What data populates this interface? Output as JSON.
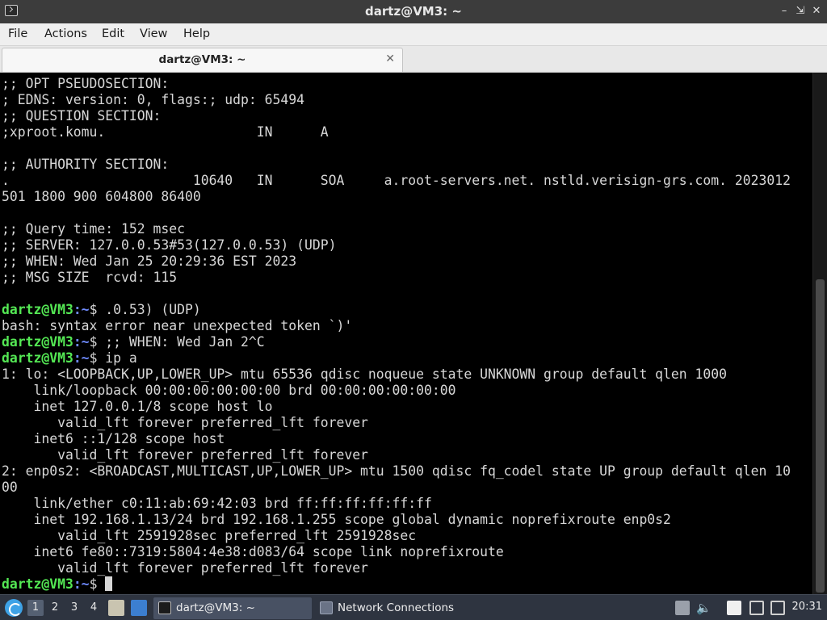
{
  "window": {
    "title": "dartz@VM3: ~",
    "controls": [
      "minimize",
      "maximize",
      "close"
    ]
  },
  "menubar": {
    "items": [
      "File",
      "Actions",
      "Edit",
      "View",
      "Help"
    ]
  },
  "tab": {
    "label": "dartz@VM3: ~"
  },
  "terminal": {
    "lines": [
      {
        "text": ";; OPT PSEUDOSECTION:"
      },
      {
        "text": "; EDNS: version: 0, flags:; udp: 65494"
      },
      {
        "text": ";; QUESTION SECTION:"
      },
      {
        "text": ";xproot.komu.                   IN      A"
      },
      {
        "text": ""
      },
      {
        "text": ";; AUTHORITY SECTION:"
      },
      {
        "text": ".                       10640   IN      SOA     a.root-servers.net. nstld.verisign-grs.com. 2023012"
      },
      {
        "text": "501 1800 900 604800 86400"
      },
      {
        "text": ""
      },
      {
        "text": ";; Query time: 152 msec"
      },
      {
        "text": ";; SERVER: 127.0.0.53#53(127.0.0.53) (UDP)"
      },
      {
        "text": ";; WHEN: Wed Jan 25 20:29:36 EST 2023"
      },
      {
        "text": ";; MSG SIZE  rcvd: 115"
      },
      {
        "text": ""
      },
      {
        "prompt": true,
        "user": "dartz@VM3",
        "path": ":~",
        "cmd": "$ .0.53) (UDP)"
      },
      {
        "text": "bash: syntax error near unexpected token `)'"
      },
      {
        "prompt": true,
        "user": "dartz@VM3",
        "path": ":~",
        "cmd": "$ ;; WHEN: Wed Jan 2^C"
      },
      {
        "prompt": true,
        "user": "dartz@VM3",
        "path": ":~",
        "cmd": "$ ip a"
      },
      {
        "text": "1: lo: <LOOPBACK,UP,LOWER_UP> mtu 65536 qdisc noqueue state UNKNOWN group default qlen 1000"
      },
      {
        "text": "    link/loopback 00:00:00:00:00:00 brd 00:00:00:00:00:00"
      },
      {
        "text": "    inet 127.0.0.1/8 scope host lo"
      },
      {
        "text": "       valid_lft forever preferred_lft forever"
      },
      {
        "text": "    inet6 ::1/128 scope host"
      },
      {
        "text": "       valid_lft forever preferred_lft forever"
      },
      {
        "text": "2: enp0s2: <BROADCAST,MULTICAST,UP,LOWER_UP> mtu 1500 qdisc fq_codel state UP group default qlen 10"
      },
      {
        "text": "00"
      },
      {
        "text": "    link/ether c0:11:ab:69:42:03 brd ff:ff:ff:ff:ff:ff"
      },
      {
        "text": "    inet 192.168.1.13/24 brd 192.168.1.255 scope global dynamic noprefixroute enp0s2"
      },
      {
        "text": "       valid_lft 2591928sec preferred_lft 2591928sec"
      },
      {
        "text": "    inet6 fe80::7319:5804:4e38:d083/64 scope link noprefixroute"
      },
      {
        "text": "       valid_lft forever preferred_lft forever"
      },
      {
        "prompt": true,
        "user": "dartz@VM3",
        "path": ":~",
        "cmd": "$ ",
        "cursor": true
      }
    ]
  },
  "taskbar": {
    "workspaces": [
      "1",
      "2",
      "3",
      "4"
    ],
    "active_workspace": "1",
    "tasks": [
      {
        "label": "dartz@VM3: ~",
        "icon": "terminal-icon",
        "active": true
      },
      {
        "label": "Network Connections",
        "icon": "network-icon",
        "active": false
      }
    ],
    "tray_icons": [
      "notes-icon",
      "volume-icon",
      "clipboard-icon",
      "monitor-icon",
      "network-status-icon"
    ],
    "clock": "20:31"
  },
  "colors": {
    "prompt_user": "#54e854",
    "prompt_path": "#6f8bff",
    "terminal_text": "#d7d7d7",
    "terminal_bg": "#000000",
    "taskbar_bg": "#2e3440"
  }
}
